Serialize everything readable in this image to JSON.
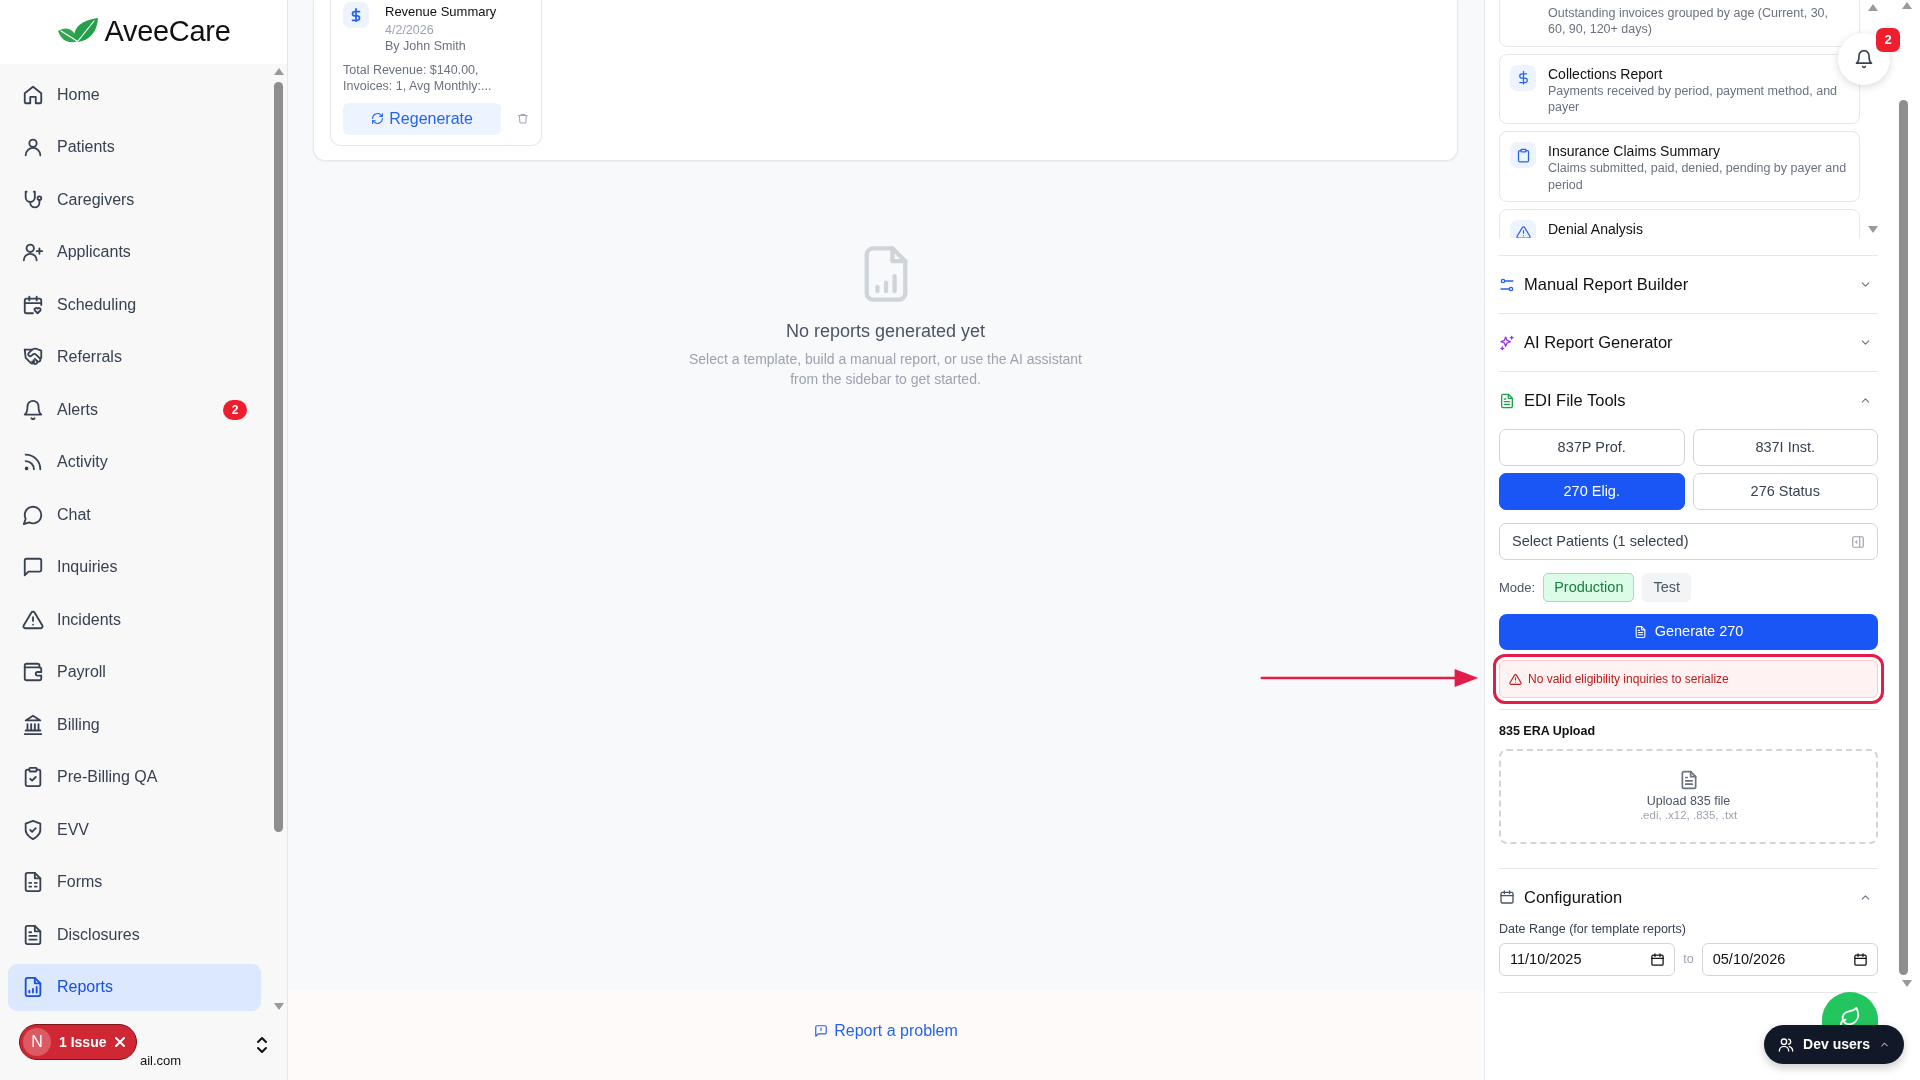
{
  "sidebar": {
    "logo": "AveeCare",
    "items": [
      {
        "label": "Home",
        "selected": false
      },
      {
        "label": "Patients",
        "selected": false
      },
      {
        "label": "Caregivers",
        "selected": false
      },
      {
        "label": "Applicants",
        "selected": false
      },
      {
        "label": "Scheduling",
        "selected": false
      },
      {
        "label": "Referrals",
        "selected": false
      },
      {
        "label": "Alerts",
        "badge": "2",
        "selected": false
      },
      {
        "label": "Activity",
        "selected": false
      },
      {
        "label": "Chat",
        "selected": false
      },
      {
        "label": "Inquiries",
        "selected": false
      },
      {
        "label": "Incidents",
        "selected": false
      },
      {
        "label": "Payroll",
        "selected": false
      },
      {
        "label": "Billing",
        "selected": false
      },
      {
        "label": "Pre-Billing QA",
        "selected": false
      },
      {
        "label": "EVV",
        "selected": false
      },
      {
        "label": "Forms",
        "selected": false
      },
      {
        "label": "Disclosures",
        "selected": false
      },
      {
        "label": "Reports",
        "selected": true
      }
    ],
    "user_email": "ail.com",
    "issue_badge": {
      "avatar": "N",
      "label": "1 Issue"
    }
  },
  "report_card": {
    "title": "Revenue Summary",
    "date": "4/2/2026",
    "author": "By John Smith",
    "summary": "Total Revenue: $140.00, Invoices: 1, Avg Monthly:...",
    "action": "Regenerate"
  },
  "empty_state": {
    "title": "No reports generated yet",
    "description": "Select a template, build a manual report, or use the AI assistant from the sidebar to get started."
  },
  "footer": {
    "link": "Report a problem"
  },
  "templates": [
    {
      "description": "Outstanding invoices grouped by age (Current, 30, 60, 90, 120+ days)"
    },
    {
      "title": "Collections Report",
      "description": "Payments received by period, payment method, and payer"
    },
    {
      "title": "Insurance Claims Summary",
      "description": "Claims submitted, paid, denied, pending by payer and period"
    },
    {
      "title": "Denial Analysis"
    }
  ],
  "manual_builder": {
    "title": "Manual Report Builder",
    "expanded": false
  },
  "ai_generator": {
    "title": "AI Report Generator",
    "expanded": false
  },
  "edi_tools": {
    "title": "EDI File Tools",
    "expanded": true,
    "formats": [
      {
        "label": "837P Prof.",
        "selected": false
      },
      {
        "label": "837I Inst.",
        "selected": false
      },
      {
        "label": "270 Elig.",
        "selected": true
      },
      {
        "label": "276 Status",
        "selected": false
      }
    ],
    "patient_select": "Select Patients (1 selected)",
    "mode_label": "Mode:",
    "modes": [
      {
        "label": "Production",
        "selected": true
      },
      {
        "label": "Test",
        "selected": false
      }
    ],
    "generate": "Generate 270",
    "error": {
      "text": "No valid eligibility inquiries to serialize",
      "highlighted": true
    },
    "era": {
      "title": "835 ERA Upload",
      "prompt": "Upload 835 file",
      "types": ".edi, .x12, .835, .txt"
    }
  },
  "configuration": {
    "title": "Configuration",
    "expanded": true,
    "date_label": "Date Range (for template reports)",
    "from": "11/10/2025",
    "separator": "to",
    "to": "05/10/2026"
  },
  "notifications": {
    "count": "2"
  },
  "dev_users": {
    "label": "Dev users"
  }
}
